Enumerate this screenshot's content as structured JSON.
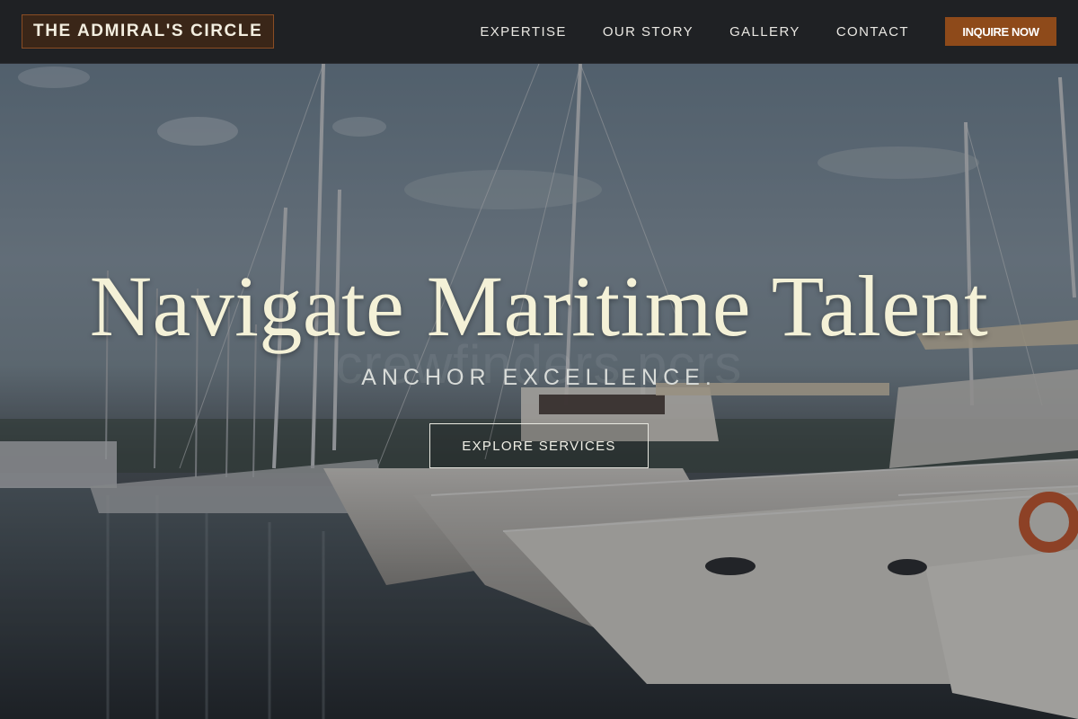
{
  "brand": {
    "name": "THE ADMIRAL'S CIRCLE"
  },
  "nav": {
    "links": [
      {
        "label": "EXPERTISE"
      },
      {
        "label": "OUR STORY"
      },
      {
        "label": "GALLERY"
      },
      {
        "label": "CONTACT"
      }
    ],
    "cta_label": "INQUIRE NOW"
  },
  "hero": {
    "title": "Navigate Maritime Talent",
    "subtitle": "ANCHOR EXCELLENCE.",
    "button_label": "EXPLORE SERVICES",
    "watermark": "crewfinders.pcrs"
  },
  "colors": {
    "nav_bg": "#1f2124",
    "accent": "#8e4a1a",
    "brand_border": "#8a4d24",
    "title_text": "#f4f1d7"
  },
  "icons": [
    "harbor-background-image"
  ]
}
